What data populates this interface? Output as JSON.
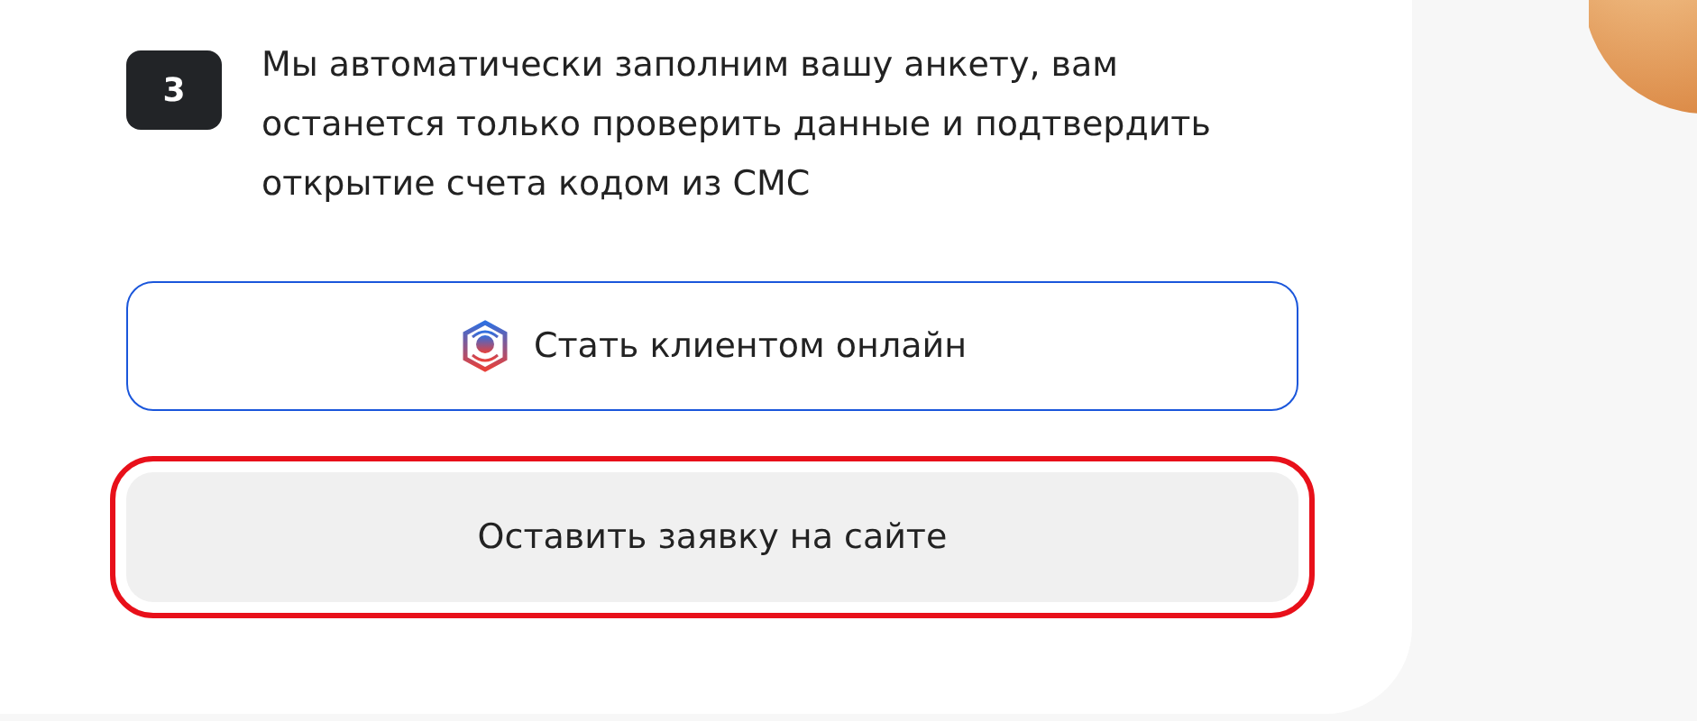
{
  "step": {
    "number": "3",
    "text": "Мы автоматически заполним вашу анкету, вам останется только проверить данные и подтвердить открытие счета кодом из СМС"
  },
  "buttons": [
    {
      "kind": "outline",
      "label": "Стать клиентом онлайн",
      "highlighted": false
    },
    {
      "kind": "filled",
      "label": "Оставить заявку на сайте",
      "highlighted": true
    }
  ]
}
